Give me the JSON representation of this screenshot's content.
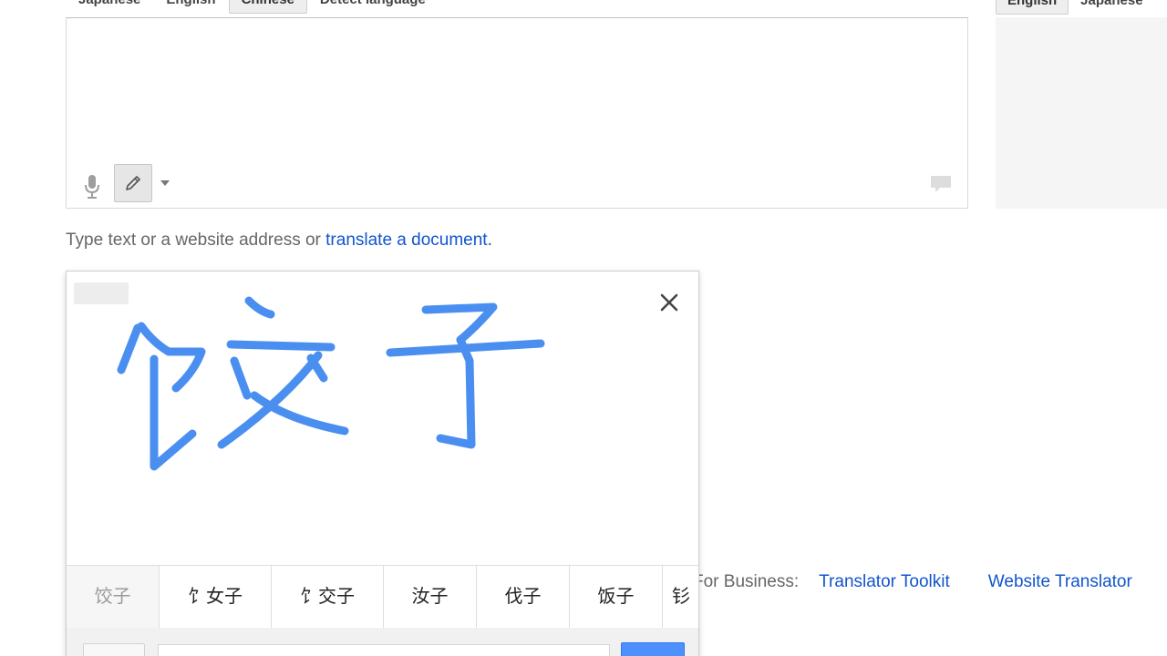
{
  "source_languages": [
    "Japanese",
    "English",
    "Chinese",
    "Detect language"
  ],
  "source_active": "Chinese",
  "target_languages": [
    "English",
    "Japanese"
  ],
  "target_active": "English",
  "source": {
    "value": "",
    "mic_icon": "microphone-icon",
    "pencil_icon": "pencil-icon",
    "dropdown_icon": "caret-down-icon",
    "comment_icon": "speech-bubble-icon"
  },
  "hint": {
    "prefix": "Type text or a website address or ",
    "link": "translate a document."
  },
  "footer": {
    "label": "For Business:",
    "links": [
      "Translator Toolkit",
      "Website Translator"
    ]
  },
  "handwriting": {
    "close_icon": "close-icon",
    "ink_color": "#4a8ff0",
    "candidates": [
      "饺子",
      "饣女子",
      "饣交子",
      "汝子",
      "伐子",
      "饭子",
      "钐"
    ]
  },
  "colors": {
    "link": "#1155cc",
    "accent": "#4d90fe"
  }
}
